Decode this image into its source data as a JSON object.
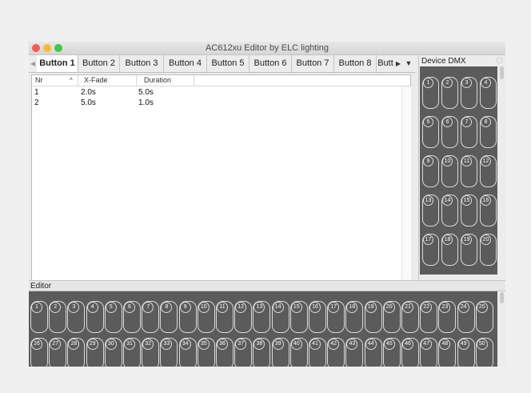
{
  "window": {
    "title": "AC612xu Editor by ELC lighting"
  },
  "tabs": [
    "Button 1",
    "Button 2",
    "Button 3",
    "Button 4",
    "Button 5",
    "Button 6",
    "Button 7",
    "Button 8",
    "Butt"
  ],
  "active_tab": "Button 1",
  "table": {
    "columns": [
      "Nr",
      "X-Fade",
      "Duration"
    ],
    "sort_indicator": "^",
    "rows": [
      {
        "nr": "1",
        "xfade": "2.0s",
        "duration": "5.0s"
      },
      {
        "nr": "2",
        "xfade": "5.0s",
        "duration": "1.0s"
      }
    ]
  },
  "device_dmx": {
    "title": "Device DMX",
    "channels": [
      "1",
      "2",
      "3",
      "4",
      "5",
      "6",
      "7",
      "8",
      "9",
      "10",
      "11",
      "12",
      "13",
      "14",
      "15",
      "16",
      "17",
      "18",
      "19",
      "20"
    ]
  },
  "editor": {
    "title": "Editor",
    "channels": [
      "1",
      "2",
      "3",
      "4",
      "5",
      "6",
      "7",
      "8",
      "9",
      "10",
      "11",
      "12",
      "13",
      "14",
      "15",
      "16",
      "17",
      "18",
      "19",
      "20",
      "21",
      "22",
      "23",
      "24",
      "25",
      "26",
      "27",
      "28",
      "29",
      "30",
      "31",
      "32",
      "33",
      "34",
      "35",
      "36",
      "37",
      "38",
      "39",
      "40",
      "41",
      "42",
      "43",
      "44",
      "45",
      "46",
      "47",
      "48",
      "49",
      "50"
    ]
  },
  "icons": [
    "close-icon",
    "minimize-icon",
    "zoom-icon",
    "tab-scroll-left-icon",
    "tab-scroll-right-icon",
    "tab-menu-icon",
    "panel-close-icon"
  ],
  "colors": {
    "panel_dark": "#5b5b5b",
    "slot_outline": "#d9d9d9"
  }
}
